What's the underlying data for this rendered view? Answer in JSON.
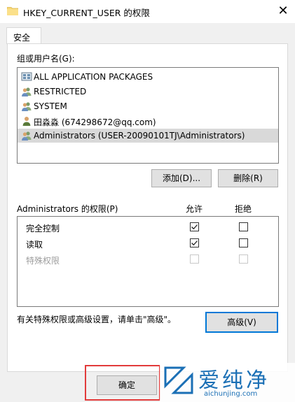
{
  "window": {
    "title": "HKEY_CURRENT_USER 的权限",
    "close_glyph": "✕"
  },
  "tabs": [
    {
      "label": "安全",
      "active": true
    }
  ],
  "groups": {
    "label": "组或用户名(G):",
    "items": [
      {
        "name": "ALL APPLICATION PACKAGES",
        "icon": "app-packages-icon"
      },
      {
        "name": "RESTRICTED",
        "icon": "user-group-icon"
      },
      {
        "name": "SYSTEM",
        "icon": "user-group-icon"
      },
      {
        "name": "田淼淼 (674298672@qq.com)",
        "icon": "user-icon"
      },
      {
        "name": "Administrators (USER-20090101TJ\\Administrators)",
        "icon": "user-group-icon",
        "selected": true
      }
    ]
  },
  "buttons": {
    "add": "添加(D)...",
    "remove": "删除(R)",
    "advanced": "高级(V)",
    "ok": "确定"
  },
  "permissions": {
    "label": "Administrators 的权限(P)",
    "allow_header": "允许",
    "deny_header": "拒绝",
    "rows": [
      {
        "name": "完全控制",
        "allow": true,
        "deny": false,
        "enabled": true
      },
      {
        "name": "读取",
        "allow": true,
        "deny": false,
        "enabled": true
      },
      {
        "name": "特殊权限",
        "allow": false,
        "deny": false,
        "enabled": false
      }
    ]
  },
  "advanced_hint": "有关特殊权限或高级设置，请单击\"高级\"。",
  "watermark": {
    "brand": "爱纯净",
    "url": "aichunjing.com"
  },
  "colors": {
    "selection": "#d9d9d9",
    "focus_border": "#0078d7",
    "highlight_box": "#e23b3b",
    "watermark": "#1a6fb5"
  }
}
